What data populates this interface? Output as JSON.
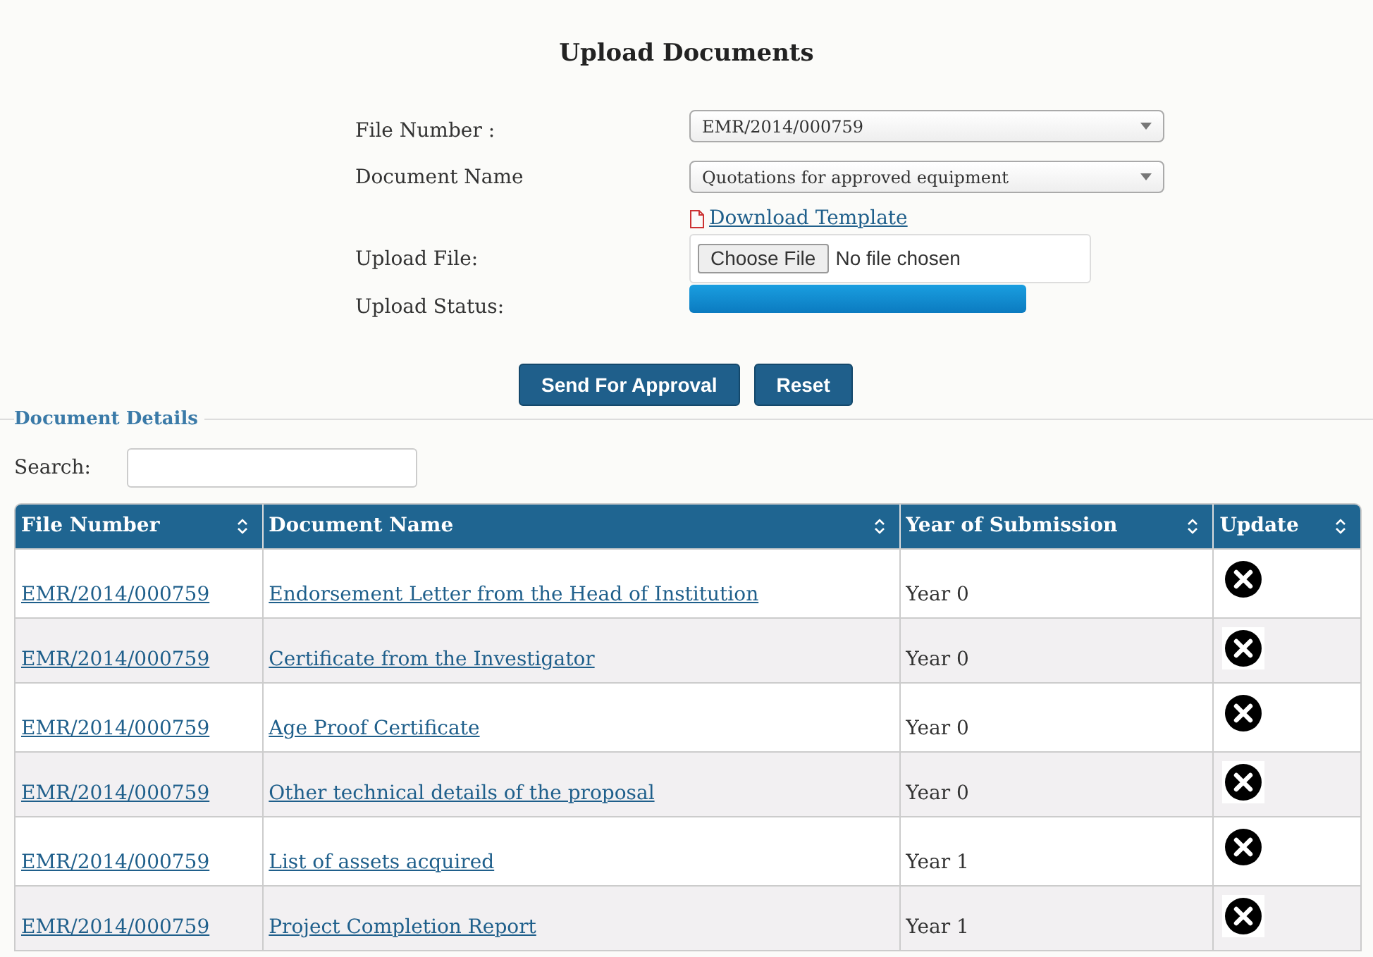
{
  "title": "Upload Documents",
  "form": {
    "file_number": {
      "label": "File Number :",
      "value": "EMR/2014/000759"
    },
    "document_name": {
      "label": "Document Name",
      "value": "Quotations for approved equipment"
    },
    "download_link": "Download Template",
    "upload_file": {
      "label": "Upload File:",
      "button": "Choose File",
      "status": "No file chosen"
    },
    "upload_status": {
      "label": "Upload Status:",
      "level": 1
    }
  },
  "buttons": [
    "Send For Approval",
    "Reset"
  ],
  "section_title": "Document Details",
  "search": {
    "label": "Search:"
  },
  "table": {
    "columns": [
      "File Number",
      "Document Name",
      "Year of Submission",
      "Update"
    ],
    "rows": [
      {
        "file_number": "EMR/2014/000759",
        "document_name": "Endorsement Letter from the Head of Institution",
        "year": "Year 0"
      },
      {
        "file_number": "EMR/2014/000759",
        "document_name": "Certificate from the Investigator",
        "year": "Year 0"
      },
      {
        "file_number": "EMR/2014/000759",
        "document_name": "Age Proof Certificate",
        "year": "Year 0"
      },
      {
        "file_number": "EMR/2014/000759",
        "document_name": "Other technical details of the proposal",
        "year": "Year 0"
      },
      {
        "file_number": "EMR/2014/000759",
        "document_name": "List of assets acquired",
        "year": "Year 1"
      },
      {
        "file_number": "EMR/2014/000759",
        "document_name": "Project Completion Report",
        "year": "Year 1"
      }
    ]
  }
}
